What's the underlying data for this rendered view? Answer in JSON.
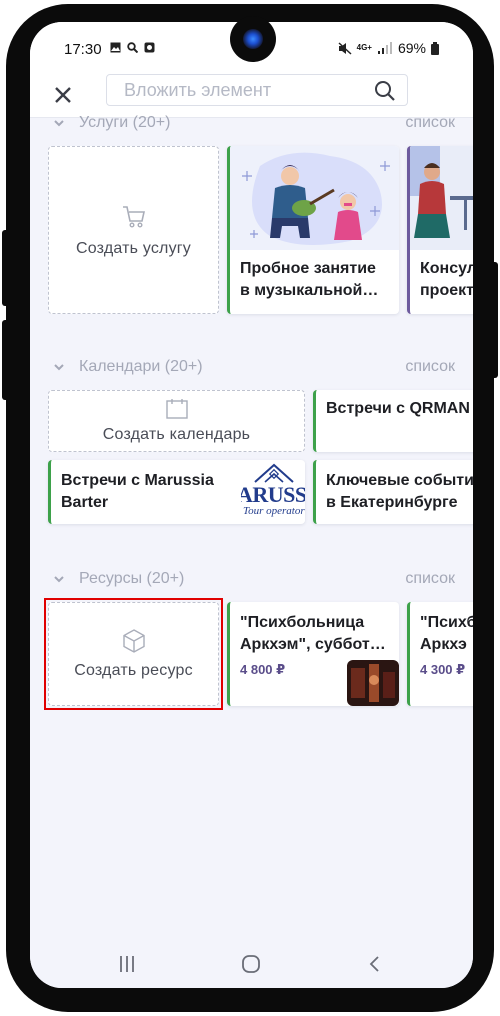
{
  "status_bar": {
    "time": "17:30",
    "network": "4G+",
    "battery": "69%"
  },
  "search": {
    "placeholder": "Вложить элемент"
  },
  "sections": {
    "services": {
      "title": "Услуги (20+)",
      "view_link": "список",
      "create_label": "Создать услугу",
      "items": [
        {
          "title_line1": "Пробное занятие",
          "title_line2": "в музыкальной…"
        },
        {
          "title_line1": "Консул",
          "title_line2": "проект"
        }
      ]
    },
    "calendars": {
      "title": "Календари (20+)",
      "view_link": "список",
      "create_label": "Создать календарь",
      "items": [
        {
          "title_line1": "Встречи с QRMAN",
          "title_line2": ""
        },
        {
          "title_line1": "Встречи с Marussia",
          "title_line2": "Barter",
          "logo_text": "ARUSS",
          "logo_sub": "Tour operator"
        },
        {
          "title_line1": "Ключевые событи",
          "title_line2": "в Екатеринбурге"
        }
      ]
    },
    "resources": {
      "title": "Ресурсы (20+)",
      "view_link": "список",
      "create_label": "Создать ресурс",
      "items": [
        {
          "title_line1": "\"Психбольница",
          "title_line2": "Аркхэм\", суббот…",
          "price": "4 800 ₽"
        },
        {
          "title_line1": "\"Психб",
          "title_line2": "Аркхэ",
          "price": "4 300 ₽"
        }
      ]
    }
  },
  "colors": {
    "accent_green": "#3da14a",
    "accent_purple": "#6e5b9e",
    "highlight_red": "#e00000",
    "background": "#f3f4fb"
  },
  "icons": [
    "close-icon",
    "search-icon",
    "chevron-down-icon",
    "cart-icon",
    "calendar-icon",
    "cube-icon",
    "recent-apps-icon",
    "home-icon",
    "back-icon"
  ]
}
